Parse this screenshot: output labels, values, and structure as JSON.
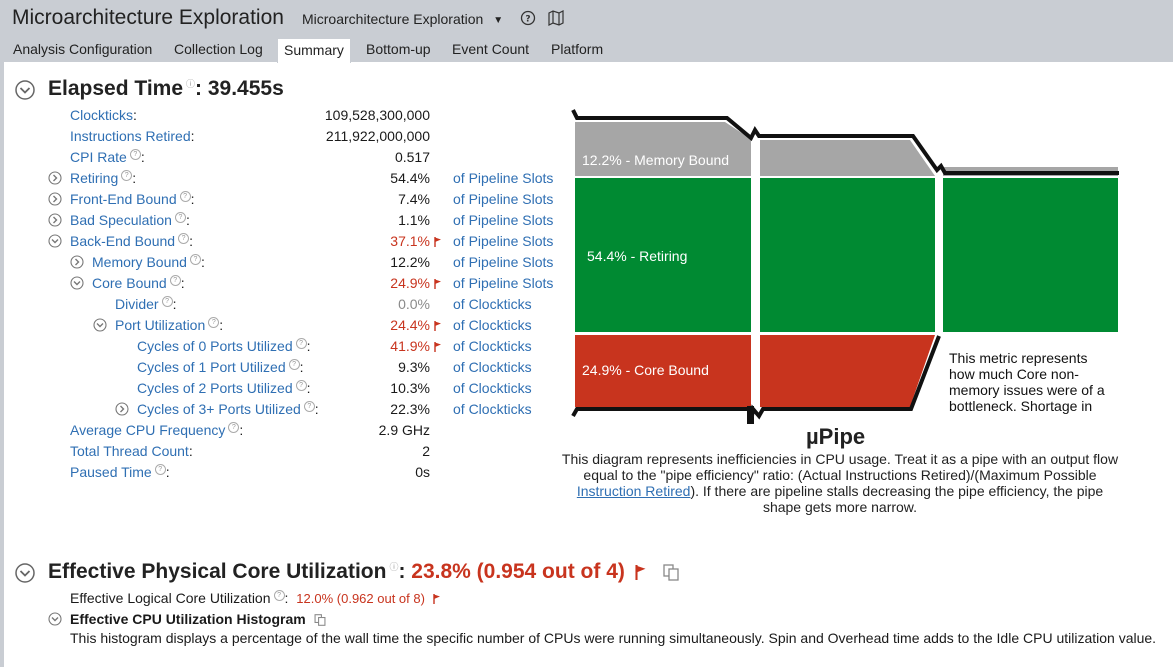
{
  "app_title": "Microarchitecture Exploration",
  "viewpoint": "Microarchitecture Exploration",
  "tabs": [
    "Analysis Configuration",
    "Collection Log",
    "Summary",
    "Bottom-up",
    "Event Count",
    "Platform"
  ],
  "active_tab": "Summary",
  "elapsed": {
    "label": "Elapsed Time",
    "value": ": 39.455s"
  },
  "metrics": [
    {
      "label": "Clockticks",
      "value": "109,528,300,000",
      "unit": ""
    },
    {
      "label": "Instructions Retired",
      "value": "211,922,000,000",
      "unit": ""
    },
    {
      "label": "CPI Rate",
      "value": "0.517",
      "unit": ""
    },
    {
      "label": "Retiring",
      "value": "54.4%",
      "unit": "of Pipeline Slots"
    },
    {
      "label": "Front-End Bound",
      "value": "7.4%",
      "unit": "of Pipeline Slots"
    },
    {
      "label": "Bad Speculation",
      "value": "1.1%",
      "unit": "of Pipeline Slots"
    },
    {
      "label": "Back-End Bound",
      "value": "37.1%",
      "unit": "of Pipeline Slots"
    },
    {
      "label": "Memory Bound",
      "value": "12.2%",
      "unit": "of Pipeline Slots"
    },
    {
      "label": "Core Bound",
      "value": "24.9%",
      "unit": "of Pipeline Slots"
    },
    {
      "label": "Divider",
      "value": "0.0%",
      "unit": "of Clockticks"
    },
    {
      "label": "Port Utilization",
      "value": "24.4%",
      "unit": "of Clockticks"
    },
    {
      "label": "Cycles of 0 Ports Utilized",
      "value": "41.9%",
      "unit": "of Clockticks"
    },
    {
      "label": "Cycles of 1 Port Utilized",
      "value": "9.3%",
      "unit": "of Clockticks"
    },
    {
      "label": "Cycles of 2 Ports Utilized",
      "value": "10.3%",
      "unit": "of Clockticks"
    },
    {
      "label": "Cycles of 3+ Ports Utilized",
      "value": "22.3%",
      "unit": "of Clockticks"
    },
    {
      "label": "Average CPU Frequency",
      "value": "2.9 GHz",
      "unit": ""
    },
    {
      "label": "Total Thread Count",
      "value": "2",
      "unit": ""
    },
    {
      "label": "Paused Time",
      "value": "0s",
      "unit": ""
    }
  ],
  "pipe": {
    "memory_label": "12.2% - Memory Bound",
    "retiring_label": "54.4% - Retiring",
    "core_label": "24.9% - Core Bound",
    "title": "µPipe",
    "tooltip": "This metric represents how much Core non-memory issues were of a bottleneck. Shortage in",
    "caption_1": "This diagram represents inefficiencies in CPU usage. Treat it as a pipe with an output flow equal to the \"pipe efficiency\" ratio: (Actual Instructions Retired)/(Maximum Possible",
    "caption_link": "Instruction Retired",
    "caption_2": "). If there are pipeline stalls decreasing the pipe efficiency, the pipe shape gets more narrow.",
    "colors": {
      "memory": "#a6a6a6",
      "retiring": "#008a32",
      "core": "#c8341e"
    }
  },
  "core_util": {
    "label": "Effective Physical Core Utilization",
    "sep": ":",
    "value": "23.8% (0.954 out of 4)"
  },
  "logical_util": {
    "label": "Effective Logical Core Utilization",
    "value": "12.0% (0.962 out of 8)"
  },
  "histogram": {
    "title": "Effective CPU Utilization Histogram",
    "desc": "This histogram displays a percentage of the wall time the specific number of CPUs were running simultaneously. Spin and Overhead time adds to the Idle CPU utilization value."
  }
}
